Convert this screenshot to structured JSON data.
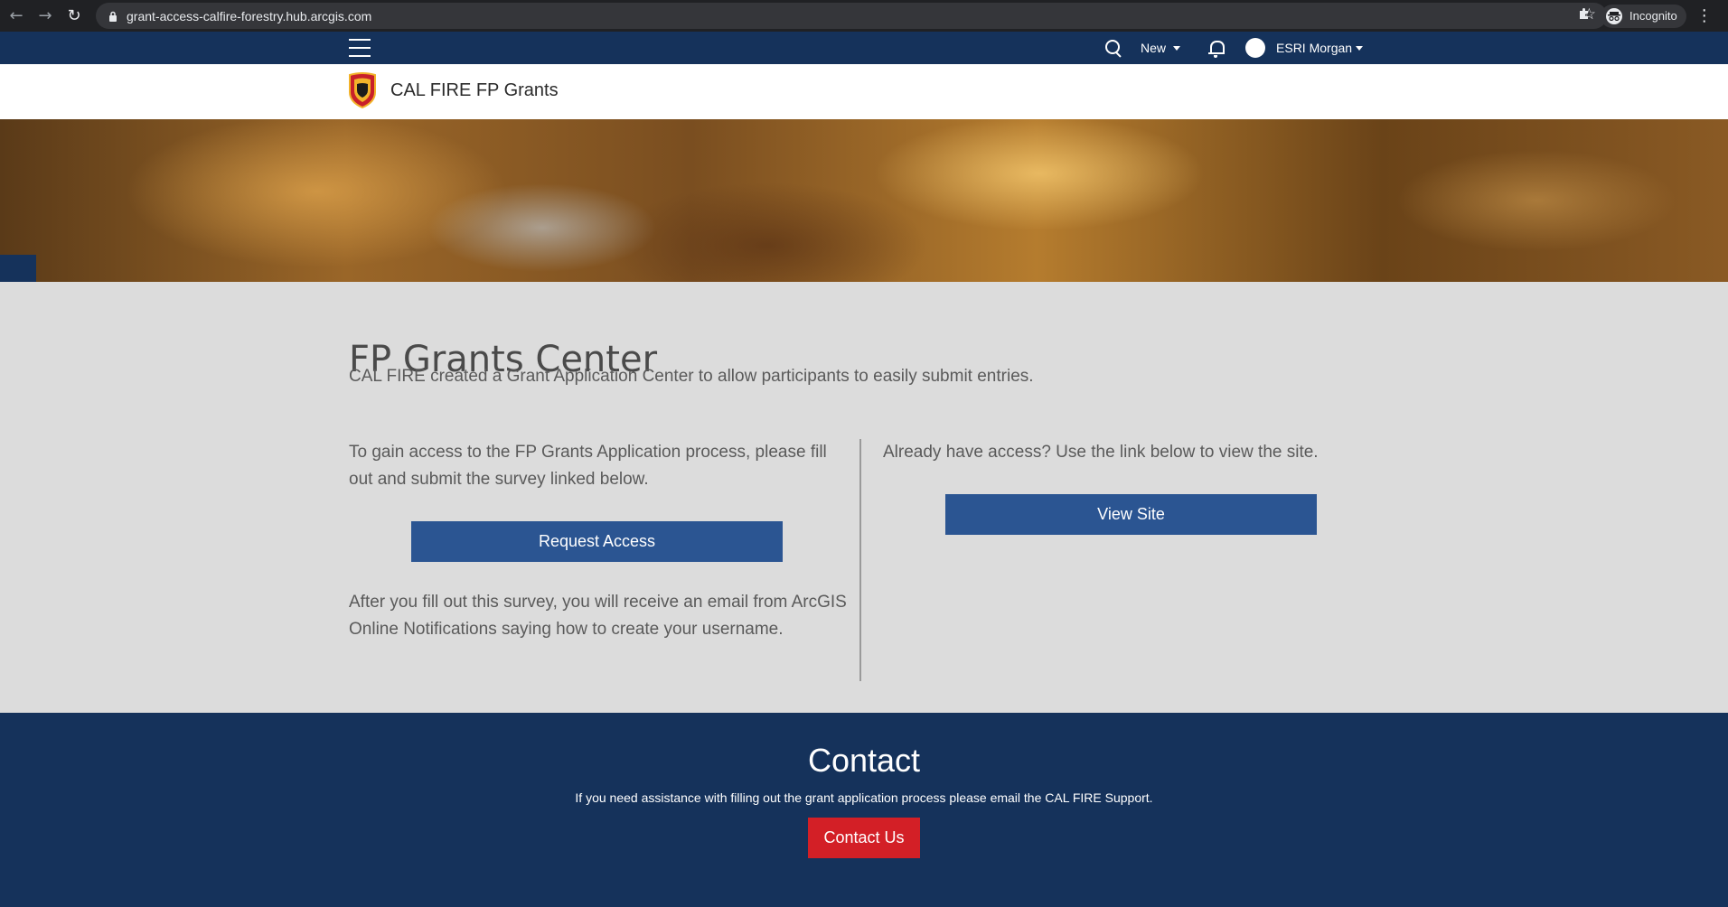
{
  "browser": {
    "url": "grant-access-calfire-forestry.hub.arcgis.com",
    "incognito_label": "Incognito",
    "icons": [
      "back-icon",
      "forward-icon",
      "reload-icon",
      "lock-icon",
      "star-icon",
      "extensions-icon",
      "incognito-icon",
      "menu-icon"
    ]
  },
  "topnav": {
    "new_label": "New",
    "user_name": "ESRI Morgan"
  },
  "site": {
    "title": "CAL FIRE FP Grants",
    "logo_text": "CAL FIRE"
  },
  "main": {
    "title": "FP Grants Center",
    "intro": "CAL FIRE created a Grant Application Center to allow participants to easily submit entries.",
    "left_text": "To gain access to the FP Grants Application process, please fill out and submit the survey linked below.",
    "request_button": "Request Access",
    "after_text": "After you fill out this survey, you will receive an email from ArcGIS Online Notifications saying how to create your username.",
    "right_text": "Already have access? Use the link below to view the site.",
    "view_button": "View Site"
  },
  "contact": {
    "title": "Contact",
    "message": "If you need assistance with filling out the grant application process please email the CAL FIRE Support.",
    "button": "Contact Us"
  },
  "colors": {
    "navy": "#15325b",
    "button_blue": "#2b5592",
    "button_red": "#d31f26",
    "background": "#dcdcdc"
  }
}
